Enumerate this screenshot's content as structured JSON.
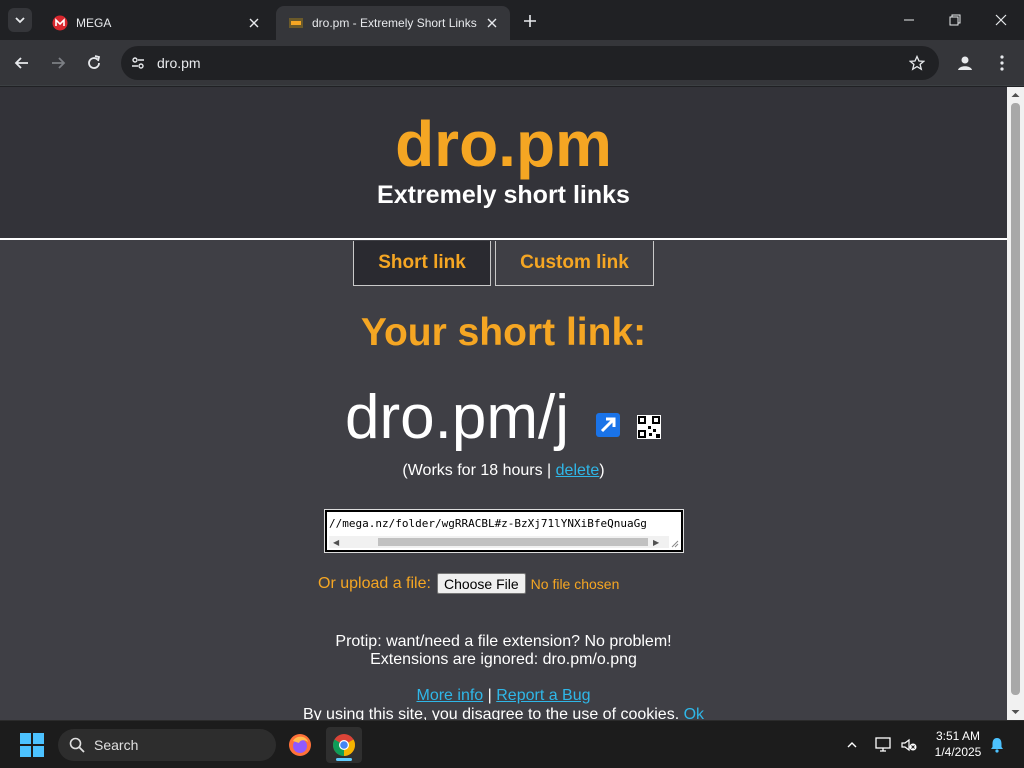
{
  "browser": {
    "tabs": [
      {
        "title": "MEGA",
        "favicon": "mega-icon",
        "active": false
      },
      {
        "title": "dro.pm - Extremely Short Links",
        "favicon": "dropm-favicon",
        "active": true
      }
    ],
    "address": "dro.pm"
  },
  "site": {
    "logo": "dro.pm",
    "tagline": "Extremely short links",
    "tabs": {
      "short": "Short link",
      "custom": "Custom link"
    },
    "heading": "Your short link:",
    "short_link": "dro.pm/j",
    "works_prefix": "(Works for 18 hours | ",
    "delete_label": "delete",
    "works_suffix": ")",
    "url_value": "//mega.nz/folder/wgRRACBL#z-BzXj71lYNXiBfeQnuaGg",
    "upload_label": "Or upload a file:",
    "choose_file": "Choose File",
    "no_file": "No file chosen",
    "protip_line1": "Protip: want/need a file extension? No problem!",
    "protip_line2": "Extensions are ignored: dro.pm/o.png",
    "more_info": "More info",
    "separator": " | ",
    "report_bug": "Report a Bug",
    "cookie_text": "By using this site, you disagree to the use of cookies.",
    "cookie_ok": "Ok"
  },
  "taskbar": {
    "search_label": "Search",
    "time": "3:51 AM",
    "date": "1/4/2025"
  },
  "colors": {
    "accent_orange": "#f5a623",
    "link_blue": "#2fb7e8",
    "page_bg": "#3f3f45"
  }
}
